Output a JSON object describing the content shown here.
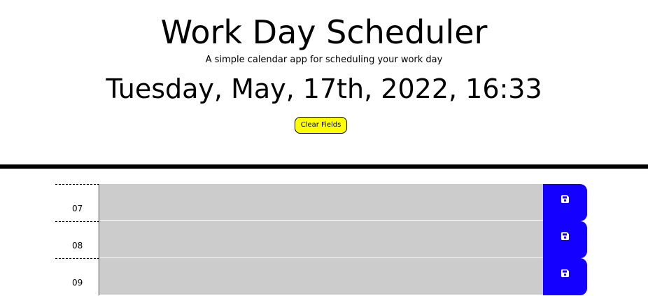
{
  "header": {
    "title": "Work Day Scheduler",
    "subtitle": "A simple calendar app for scheduling your work day",
    "current_date": "Tuesday, May, 17th, 2022, 16:33",
    "clear_label": "Clear Fields"
  },
  "colors": {
    "clear_button": "#ffff00",
    "past_block": "#cccccc",
    "save_button": "#1400ff"
  },
  "schedule": {
    "rows": [
      {
        "hour": "07",
        "description": "",
        "icon": "save-icon"
      },
      {
        "hour": "08",
        "description": "",
        "icon": "save-icon"
      },
      {
        "hour": "09",
        "description": "",
        "icon": "save-icon"
      }
    ]
  }
}
